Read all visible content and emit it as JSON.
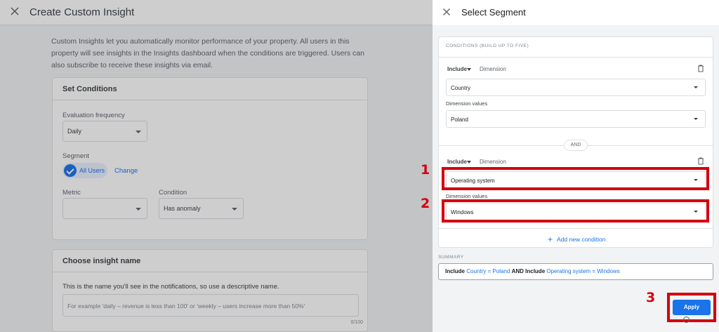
{
  "left_dialog": {
    "title": "Create Custom Insight",
    "intro_text": "Custom Insights let you automatically monitor performance of your property. All users in this property will see insights in the Insights dashboard when the conditions are triggered. Users can also subscribe to receive these insights via email.",
    "set_conditions": {
      "title": "Set Conditions",
      "evaluation_frequency_label": "Evaluation frequency",
      "evaluation_frequency_value": "Daily",
      "segment_label": "Segment",
      "segment_chip": "All Users",
      "change_link": "Change",
      "metric_label": "Metric",
      "metric_value": "",
      "condition_label": "Condition",
      "condition_value": "Has anomaly"
    },
    "insight_name": {
      "title": "Choose insight name",
      "description": "This is the name you'll see in the notifications, so use a descriptive name.",
      "placeholder": "For example 'daily – revenue is less than 100' or 'weekly – users increase more than 50%'",
      "counter": "0/100"
    }
  },
  "select_segment": {
    "title": "Select Segment",
    "conditions_heading": "CONDITIONS (BUILD UP TO FIVE)",
    "conditions": [
      {
        "include_label": "Include",
        "dimension_label": "Dimension",
        "dimension_value": "Country",
        "dimension_values_label": "Dimension values",
        "dimension_values_value": "Poland"
      },
      {
        "include_label": "Include",
        "dimension_label": "Dimension",
        "dimension_value": "Operating system",
        "dimension_values_label": "Dimension values",
        "dimension_values_value": "Windows"
      }
    ],
    "and_label": "AND",
    "add_condition": "Add new condition",
    "summary_label": "SUMMARY",
    "summary": {
      "include1": "Include",
      "dim1": "Country",
      "eq1": "=",
      "val1": "Poland",
      "and": "AND",
      "include2": "Include",
      "dim2": "Operating system",
      "eq2": "=",
      "val2": "Windows"
    },
    "apply_label": "Apply"
  },
  "annotations": [
    "1",
    "2",
    "3"
  ],
  "colors": {
    "accent": "#1a73e8",
    "highlight": "#d3000f"
  }
}
